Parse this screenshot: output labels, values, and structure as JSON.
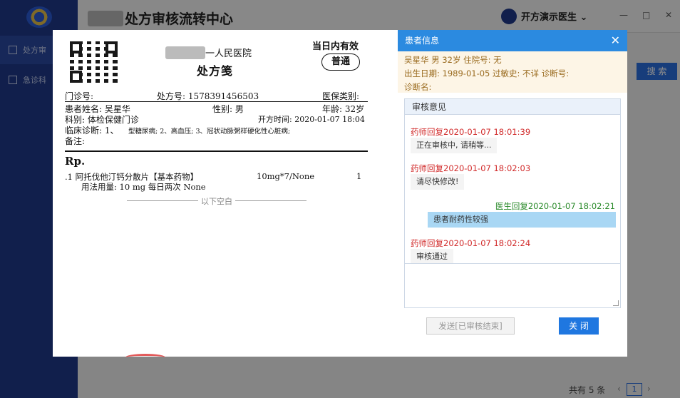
{
  "app": {
    "title_suffix": "处方审核流转中心",
    "user_name": "开方演示医生",
    "window_controls": [
      "—",
      "□",
      "✕"
    ]
  },
  "sidebar": {
    "items": [
      {
        "label": "处方审",
        "icon": "document-icon"
      },
      {
        "label": "急诊科",
        "icon": "layout-icon"
      }
    ]
  },
  "toolbar": {
    "search_label": "搜 索"
  },
  "pagination": {
    "total_label": "共有 5 条",
    "current_page": "1",
    "prev": "‹",
    "next": "›"
  },
  "prescription": {
    "hospital_suffix": "一人民医院",
    "title": "处方笺",
    "validity": "当日内有效",
    "type_badge": "普通",
    "outpatient_no_label": "门诊号:",
    "rx_no": "处方号: 1578391456503",
    "insurance_label": "医保类别:",
    "patient_name": "患者姓名: 吴星华",
    "gender": "性别: 男",
    "age": "年龄: 32岁",
    "department": "科别: 体检保健门诊",
    "issue_time": "开方时间: 2020-01-07 18:04",
    "diagnosis_label": "临床诊断: 1、",
    "diagnosis_text": "型糖尿病; 2、高血压; 3、冠状动脉粥样硬化性心脏病;",
    "remark_label": "备注:",
    "rp_label": "Rp.",
    "drug_line": ".1 阿托伐他汀钙分散片【基本药物】",
    "drug_spec": "10mg*7/None",
    "drug_qty": "1",
    "usage": "用法用量: 10 mg 每日两次 None",
    "blank_below": "以下空白"
  },
  "patient_panel": {
    "title": "患者信息",
    "close_icon": "✕",
    "line1": "吴星华   男   32岁   住院号: 无",
    "line2": "出生日期: 1989-01-05   过敏史: 不详   诊断号:",
    "line3": "诊断名:",
    "review_title": "审核意见",
    "messages": [
      {
        "role": "pharmacist",
        "meta": "药师回复2020-01-07 18:01:39",
        "text": "正在审核中, 请稍等..."
      },
      {
        "role": "pharmacist",
        "meta": "药师回复2020-01-07 18:02:03",
        "text": "请尽快修改!"
      },
      {
        "role": "doctor",
        "meta": "医生回复2020-01-07 18:02:21",
        "text": "患者耐药性较强"
      },
      {
        "role": "pharmacist",
        "meta": "药师回复2020-01-07 18:02:24",
        "text": "审核通过"
      }
    ],
    "send_label": "发送[已审核结束]",
    "close_label": "关 闭"
  },
  "colors": {
    "primary": "#2b8ae0",
    "pharmacist": "#d12a2a",
    "doctor": "#2a8a2a",
    "sidebar": "#1f3a8a"
  }
}
